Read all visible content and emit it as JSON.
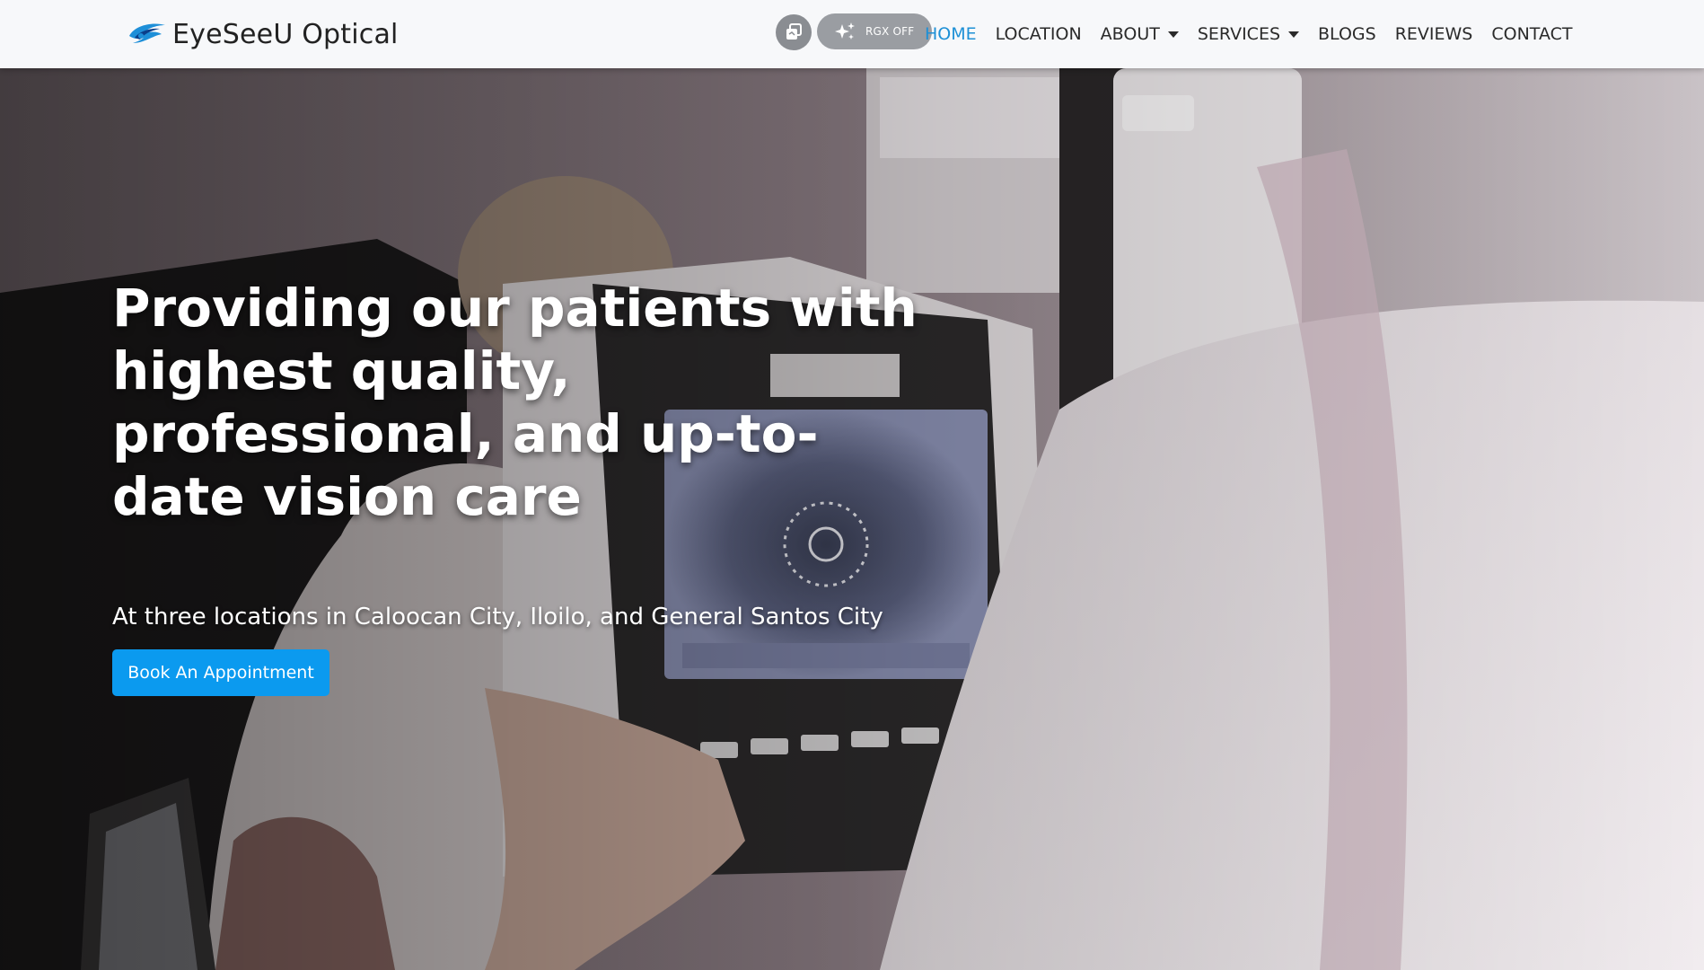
{
  "brand": {
    "name": "EyeSeeU Optical",
    "logo_icon": "eye-swirl-logo-icon"
  },
  "toolbar": {
    "copy_icon": "copy-icon",
    "rgx_icon": "sparkle-icon",
    "rgx_label": "RGX OFF"
  },
  "nav": {
    "items": [
      {
        "label": "HOME",
        "active": true
      },
      {
        "label": "LOCATION"
      },
      {
        "label": "ABOUT",
        "dropdown": true
      },
      {
        "label": "SERVICES",
        "dropdown": true
      },
      {
        "label": "BLOGS"
      },
      {
        "label": "REVIEWS"
      },
      {
        "label": "CONTACT"
      }
    ]
  },
  "hero": {
    "title": "Providing our patients with highest quality, professional, and up-to-date vision care",
    "subtitle": "At three locations in Caloocan City, Iloilo, and General Santos City",
    "cta_label": "Book An Appointment"
  },
  "colors": {
    "accent": "#0b9aef",
    "nav_active": "#1e90d6",
    "navbar_bg": "#f7f8fa"
  }
}
